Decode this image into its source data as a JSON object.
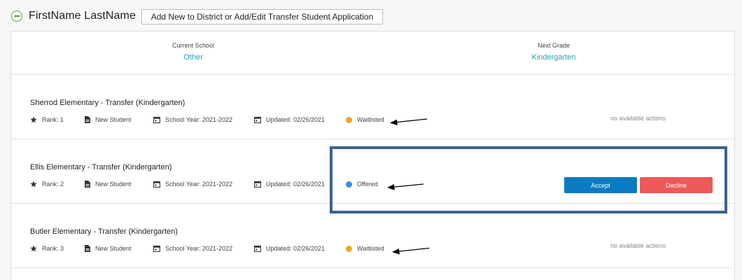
{
  "header": {
    "student_name": "FirstName LastName",
    "add_button_label": "Add New to District or Add/Edit Transfer Student Application"
  },
  "summary": {
    "current_school_label": "Current School",
    "current_school_value": "Other",
    "next_grade_label": "Next Grade",
    "next_grade_value": "Kindergarten"
  },
  "applications": [
    {
      "title": "Sherrod Elementary - Transfer (Kindergarten)",
      "rank": "Rank: 1",
      "type": "New Student",
      "school_year": "School Year: 2021-2022",
      "updated": "Updated: 02/26/2021",
      "status": "Waitlisted",
      "status_color": "#f0a521",
      "actions_text": "no available actions"
    },
    {
      "title": "Ellis Elementary - Transfer (Kindergarten)",
      "rank": "Rank: 2",
      "type": "New Student",
      "school_year": "School Year: 2021-2022",
      "updated": "Updated: 02/26/2021",
      "status": "Offered",
      "status_color": "#3b8ede",
      "accept_label": "Accept",
      "decline_label": "Decline"
    },
    {
      "title": "Butler Elementary - Transfer (Kindergarten)",
      "rank": "Rank: 3",
      "type": "New Student",
      "school_year": "School Year: 2021-2022",
      "updated": "Updated: 02/26/2021",
      "status": "Waitlisted",
      "status_color": "#f0a521",
      "actions_text": "no available actions"
    }
  ],
  "colors": {
    "accent_teal": "#2aa0a8",
    "accept_blue": "#0a7bc2",
    "decline_red": "#ec5a58",
    "highlight_border": "#3c6190",
    "collapse_green": "#5aa33c"
  },
  "icons": [
    "minus-circle-icon",
    "star-icon",
    "document-icon",
    "calendar-icon",
    "arrow-annotation-icon"
  ]
}
